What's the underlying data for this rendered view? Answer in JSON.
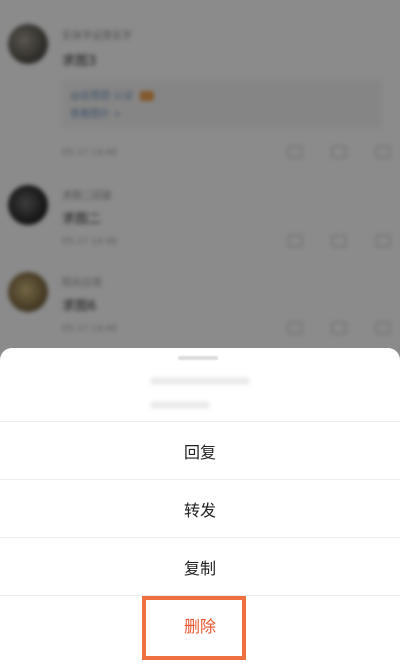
{
  "feed": {
    "comments": [
      {
        "username": "实体字运营名字",
        "text": "求图3",
        "time": "05-17 14:46",
        "quote_line1": "@运营团 认证",
        "quote_line2": "查看图片 >"
      },
      {
        "username": "求图二回复",
        "text": "求图二",
        "time": "05-17 14:46"
      },
      {
        "username": "阳光日常",
        "text": "求图6",
        "time": "05-17 14:46"
      }
    ]
  },
  "action_sheet": {
    "items": [
      {
        "label": "回复"
      },
      {
        "label": "转发"
      },
      {
        "label": "复制"
      },
      {
        "label": "删除"
      }
    ]
  },
  "colors": {
    "danger": "#e8552d",
    "highlight": "#ee6f3f",
    "overlay": "rgba(0,0,0,0.42)"
  }
}
